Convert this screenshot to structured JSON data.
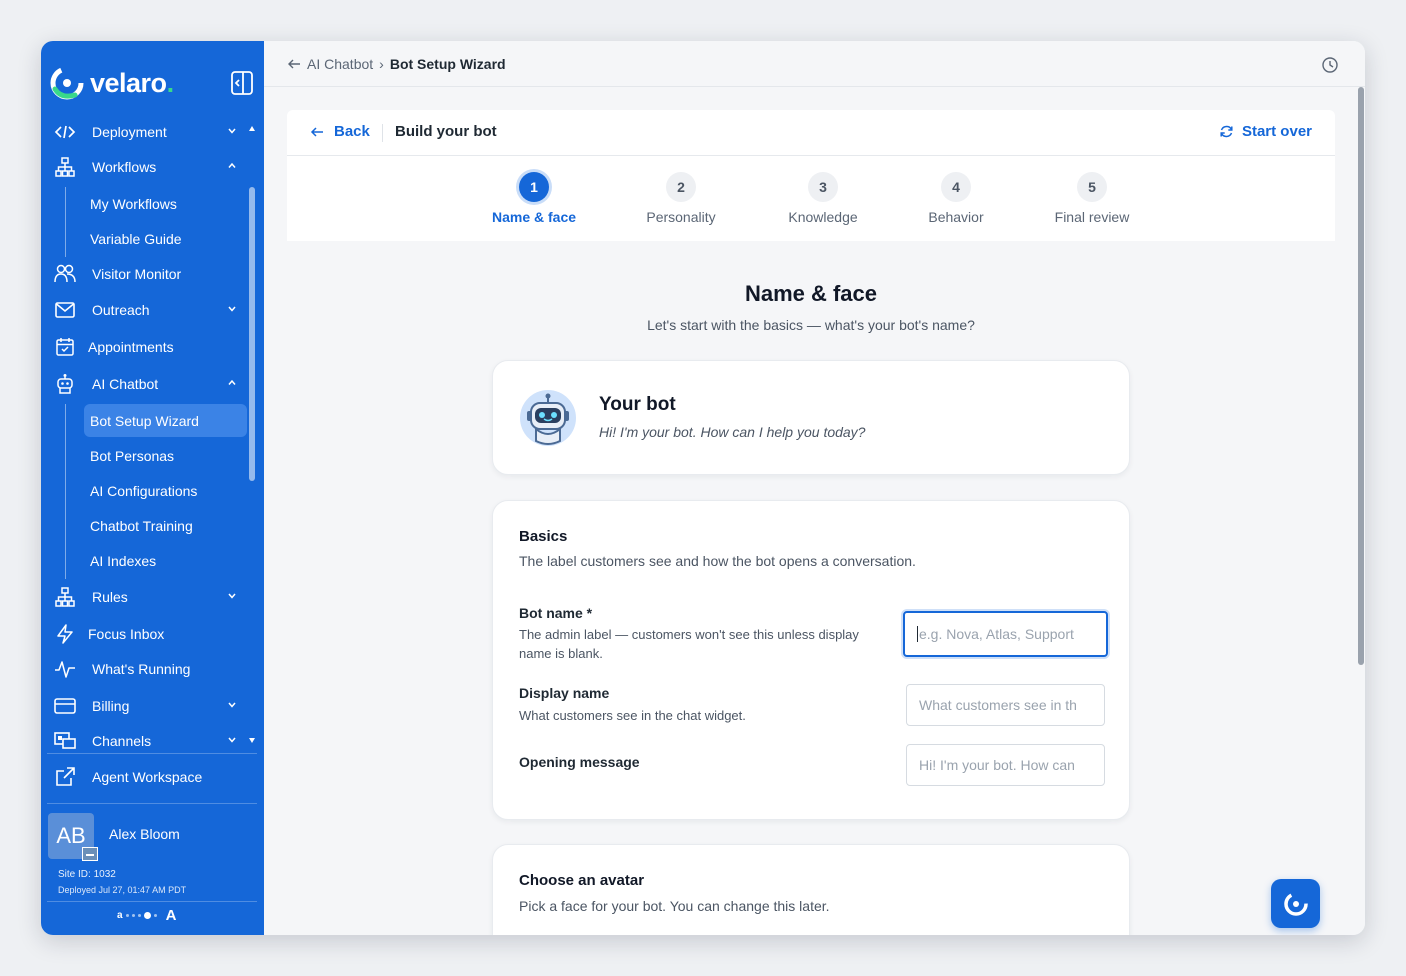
{
  "brand": {
    "name": "velaro",
    "dot": ".",
    "accent": "#1567d8",
    "green": "#39d98a"
  },
  "sidebar": {
    "items": [
      {
        "label": "Deployment",
        "icon": "code-icon",
        "chevron": "down"
      },
      {
        "label": "Workflows",
        "icon": "hierarchy-icon",
        "chevron": "up"
      },
      {
        "label": "My Workflows"
      },
      {
        "label": "Variable Guide"
      },
      {
        "label": "Visitor Monitor",
        "icon": "users-icon"
      },
      {
        "label": "Outreach",
        "icon": "mail-icon",
        "chevron": "down"
      },
      {
        "label": "Appointments",
        "icon": "calendar-icon"
      },
      {
        "label": "AI Chatbot",
        "icon": "robot-icon",
        "chevron": "up"
      },
      {
        "label": "Bot Setup Wizard"
      },
      {
        "label": "Bot Personas"
      },
      {
        "label": "AI Configurations"
      },
      {
        "label": "Chatbot Training"
      },
      {
        "label": "AI Indexes"
      },
      {
        "label": "Rules",
        "icon": "hierarchy-icon",
        "chevron": "down"
      },
      {
        "label": "Focus Inbox",
        "icon": "lightning-icon"
      },
      {
        "label": "What's Running",
        "icon": "activity-icon"
      },
      {
        "label": "Billing",
        "icon": "card-icon",
        "chevron": "down"
      },
      {
        "label": "Channels",
        "icon": "channels-icon",
        "chevron": "down"
      }
    ],
    "agent_workspace": "Agent Workspace",
    "user": {
      "initials": "AB",
      "name": "Alex Bloom",
      "site_id": "Site ID: 1032",
      "deployed": "Deployed Jul 27, 01:47 AM PDT"
    },
    "font_scale": {
      "small": "a",
      "large": "A"
    }
  },
  "topbar": {
    "parent": "AI Chatbot",
    "separator": "›",
    "current": "Bot Setup Wizard"
  },
  "wizard": {
    "back_label": "Back",
    "title": "Build your bot",
    "start_over": "Start over",
    "steps": [
      {
        "num": "1",
        "label": "Name & face"
      },
      {
        "num": "2",
        "label": "Personality"
      },
      {
        "num": "3",
        "label": "Knowledge"
      },
      {
        "num": "4",
        "label": "Behavior"
      },
      {
        "num": "5",
        "label": "Final review"
      }
    ],
    "active_step": 1
  },
  "section": {
    "title": "Name & face",
    "subtitle": "Let's start with the basics — what's your bot's name?"
  },
  "preview": {
    "title": "Your bot",
    "message": "Hi! I'm your bot. How can I help you today?"
  },
  "basics": {
    "title": "Basics",
    "subtitle": "The label customers see and how the bot opens a conversation.",
    "bot_name_label": "Bot name *",
    "bot_name_help": "The admin label — customers won't see this unless display name is blank.",
    "bot_name_placeholder": "e.g. Nova, Atlas, Support",
    "display_name_label": "Display name",
    "display_name_help": "What customers see in the chat widget.",
    "display_name_placeholder": "What customers see in th",
    "opening_label": "Opening message",
    "opening_placeholder": "Hi! I'm your bot. How can"
  },
  "avatar": {
    "title": "Choose an avatar",
    "subtitle": "Pick a face for your bot. You can change this later."
  }
}
